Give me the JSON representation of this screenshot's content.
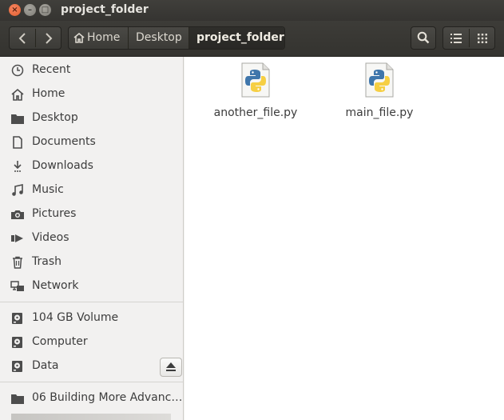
{
  "window": {
    "title": "project_folder"
  },
  "breadcrumb": [
    "Home",
    "Desktop",
    "project_folder"
  ],
  "sidebar": {
    "places": [
      {
        "label": "Recent",
        "icon": "clock-icon"
      },
      {
        "label": "Home",
        "icon": "home-icon"
      },
      {
        "label": "Desktop",
        "icon": "folder-icon"
      },
      {
        "label": "Documents",
        "icon": "document-icon"
      },
      {
        "label": "Downloads",
        "icon": "download-icon"
      },
      {
        "label": "Music",
        "icon": "music-icon"
      },
      {
        "label": "Pictures",
        "icon": "camera-icon"
      },
      {
        "label": "Videos",
        "icon": "video-icon"
      },
      {
        "label": "Trash",
        "icon": "trash-icon"
      },
      {
        "label": "Network",
        "icon": "network-icon"
      }
    ],
    "devices": [
      {
        "label": "104 GB Volume",
        "icon": "drive-icon"
      },
      {
        "label": "Computer",
        "icon": "drive-icon"
      },
      {
        "label": "Data",
        "icon": "drive-icon"
      }
    ],
    "bookmarks": [
      {
        "label": "06 Building More Advanc…",
        "icon": "folder-icon"
      }
    ]
  },
  "files": [
    {
      "name": "another_file.py",
      "icon": "python-file-icon"
    },
    {
      "name": "main_file.py",
      "icon": "python-file-icon"
    }
  ]
}
